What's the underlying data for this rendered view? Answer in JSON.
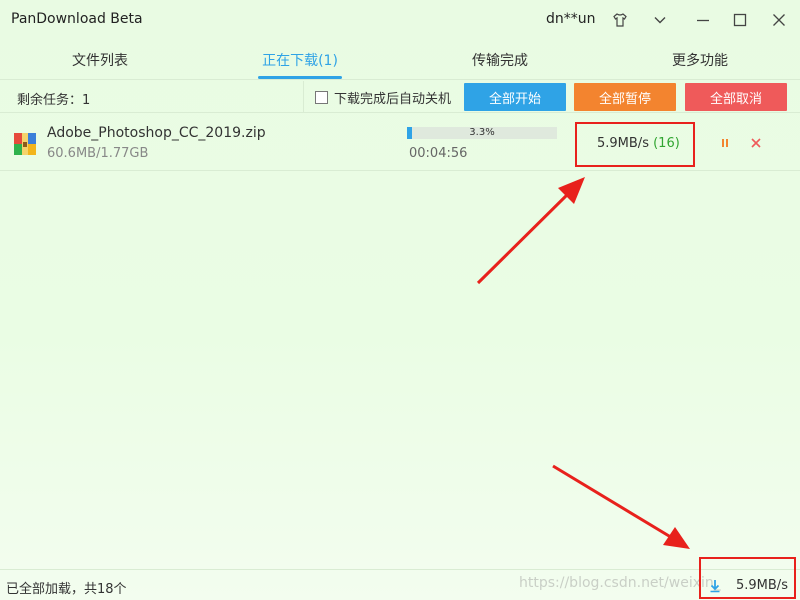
{
  "window": {
    "title": "PanDownload Beta",
    "username": "dn**un",
    "icons": [
      "shirt-icon",
      "chevron-down-icon",
      "minimize-icon",
      "maximize-icon",
      "close-icon"
    ]
  },
  "tabs": [
    {
      "label": "文件列表"
    },
    {
      "label": "正在下载(1)"
    },
    {
      "label": "传输完成"
    },
    {
      "label": "更多功能"
    }
  ],
  "toolbar": {
    "remaining_tasks": "剩余任务：1",
    "auto_shutdown_label": "下载完成后自动关机",
    "auto_shutdown_checked": false,
    "start_all": "全部开始",
    "pause_all": "全部暂停",
    "cancel_all": "全部取消"
  },
  "downloads": [
    {
      "file_name": "Adobe_Photoshop_CC_2019.zip",
      "size_text": "60.6MB/1.77GB",
      "progress_percent": 3.3,
      "progress_text": "3.3%",
      "time_left": "00:04:56",
      "speed": "5.9MB/s",
      "connections": "(16)"
    }
  ],
  "statusbar": {
    "text": "已全部加载，共18个",
    "speed": "5.9MB/s",
    "watermark": "https://blog.csdn.net/weixin_"
  },
  "colors": {
    "accent": "#2fa3e6",
    "pause": "#f3842f",
    "cancel": "#ef5a5a",
    "annotation": "#e8211c",
    "connections": "#31a531"
  }
}
